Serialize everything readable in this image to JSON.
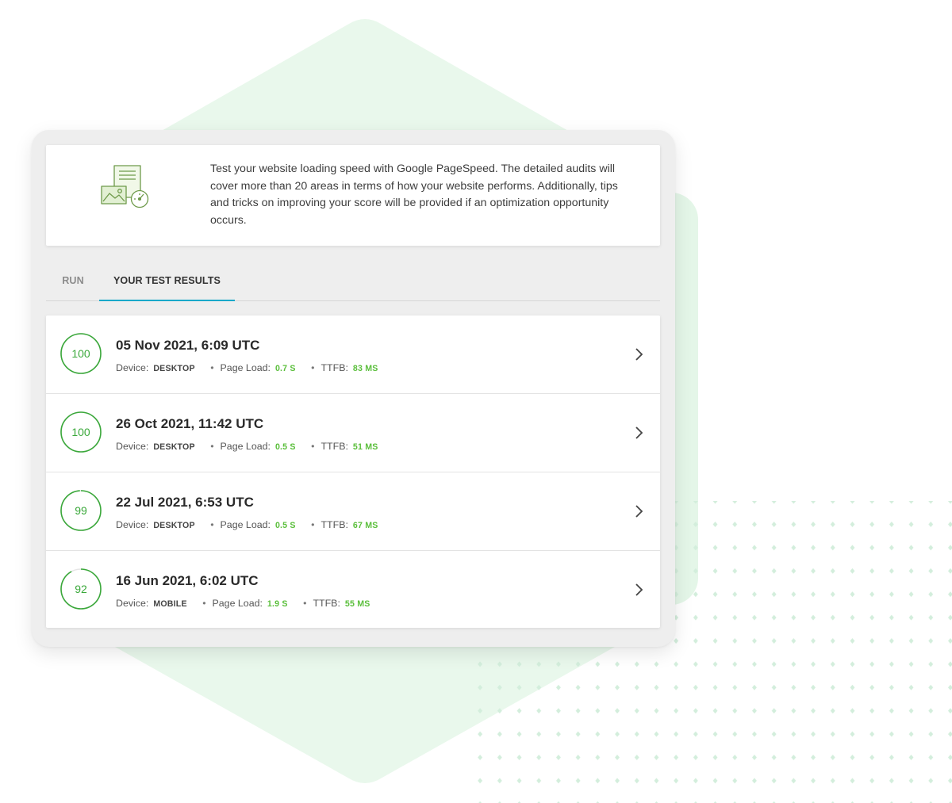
{
  "intro": {
    "text": "Test your website loading speed with Google PageSpeed. The detailed audits will cover more than 20 areas in terms of how your website performs. Additionally, tips and tricks on improving your score will be provided if an optimization opportunity occurs."
  },
  "tabs": [
    {
      "label": "RUN",
      "active": false
    },
    {
      "label": "YOUR TEST RESULTS",
      "active": true
    }
  ],
  "meta_labels": {
    "device": "Device:",
    "page_load": "Page Load:",
    "ttfb": "TTFB:",
    "separator": "•"
  },
  "results": [
    {
      "score": "100",
      "score_fraction": 1.0,
      "date": "05 Nov 2021, 6:09 UTC",
      "device": "DESKTOP",
      "page_load": "0.7 S",
      "ttfb": "83 MS"
    },
    {
      "score": "100",
      "score_fraction": 1.0,
      "date": "26 Oct 2021, 11:42 UTC",
      "device": "DESKTOP",
      "page_load": "0.5 S",
      "ttfb": "51 MS"
    },
    {
      "score": "99",
      "score_fraction": 0.99,
      "date": "22 Jul 2021, 6:53 UTC",
      "device": "DESKTOP",
      "page_load": "0.5 S",
      "ttfb": "67 MS"
    },
    {
      "score": "92",
      "score_fraction": 0.92,
      "date": "16 Jun 2021, 6:02 UTC",
      "device": "MOBILE",
      "page_load": "1.9 S",
      "ttfb": "55 MS"
    }
  ],
  "colors": {
    "score_green": "#3aa83a",
    "metric_green": "#5bbf3c",
    "tab_accent": "#17a8c9",
    "hexagon_bg": "#e9f8ec"
  },
  "icons": {
    "intro": "document-image-gauge-icon",
    "row_action": "chevron-right-icon"
  }
}
